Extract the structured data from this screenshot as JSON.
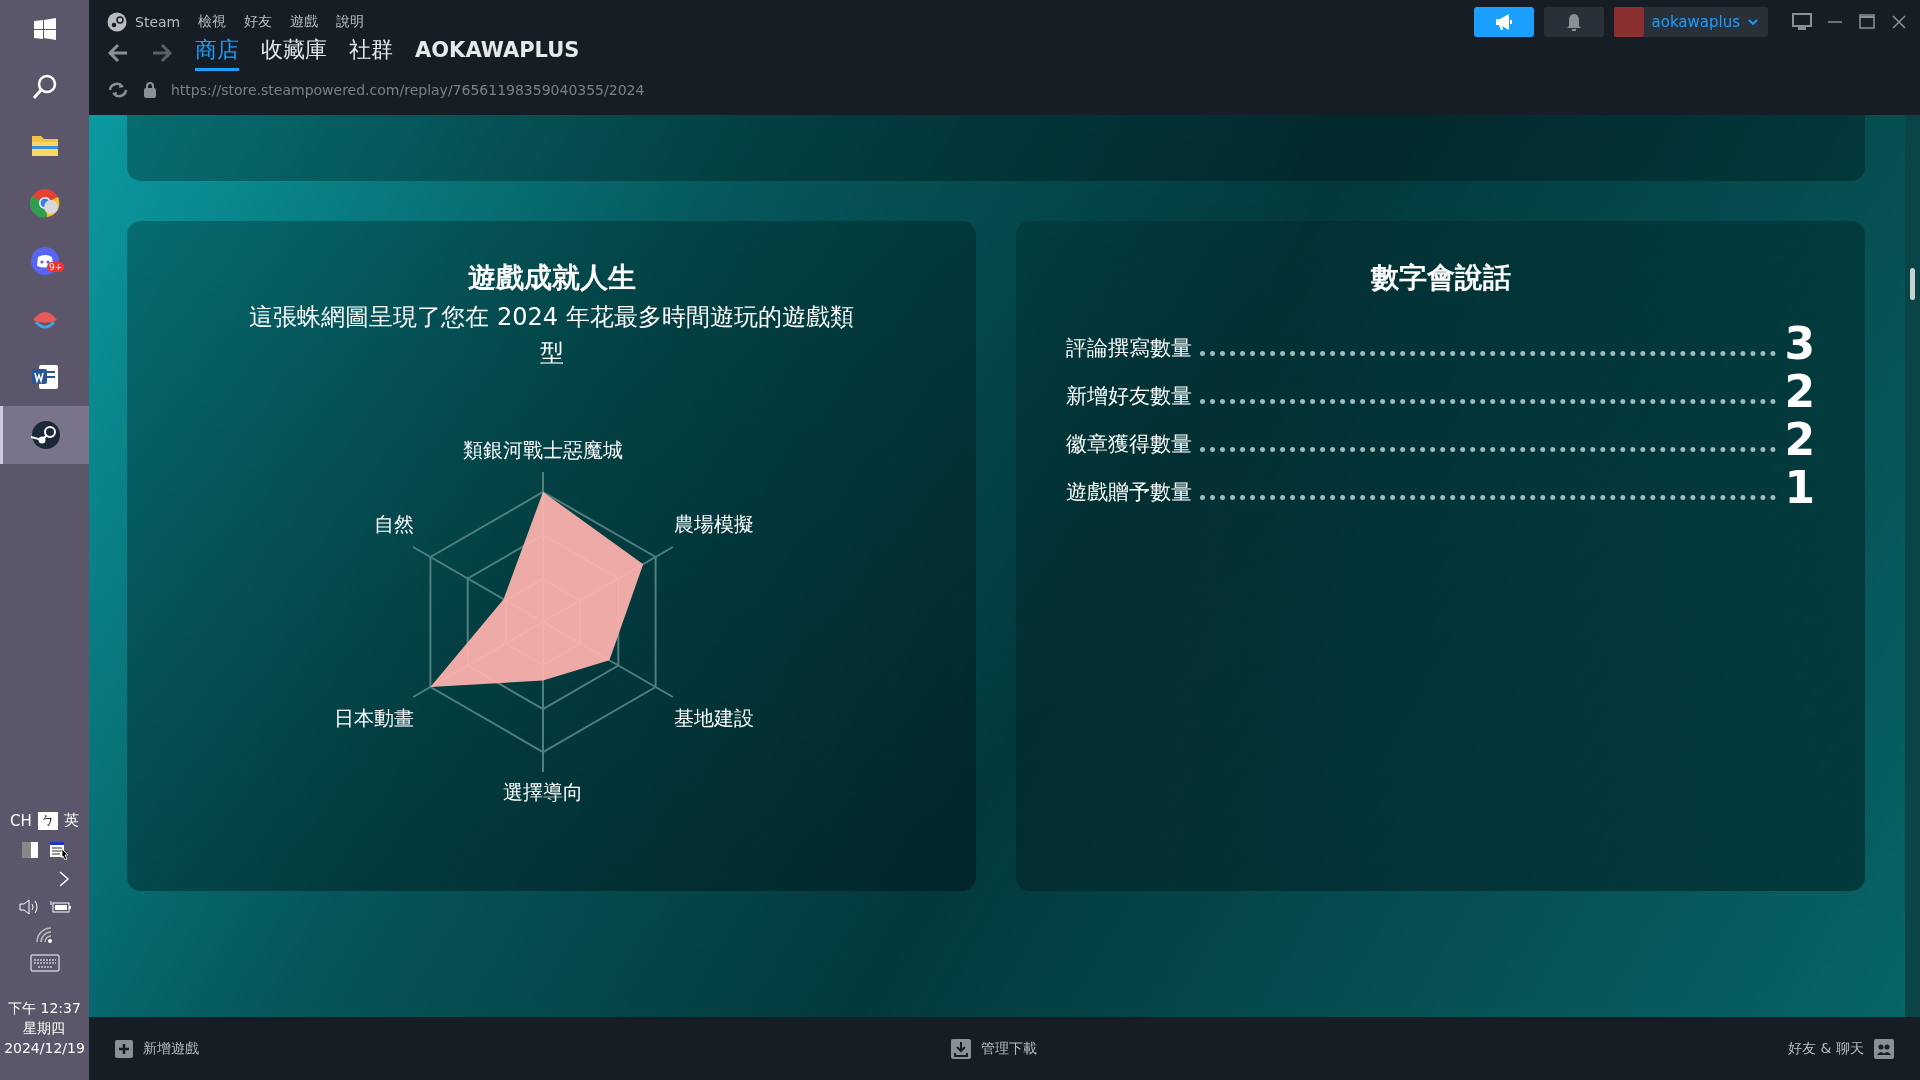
{
  "taskbar": {
    "apps": [
      {
        "kind": "start",
        "selected": false
      },
      {
        "kind": "search",
        "selected": false
      },
      {
        "kind": "folder",
        "selected": false
      },
      {
        "kind": "browser",
        "selected": false
      },
      {
        "kind": "chat",
        "selected": false,
        "badge": "9+"
      },
      {
        "kind": "shell",
        "selected": false
      },
      {
        "kind": "word",
        "selected": false
      },
      {
        "kind": "steam",
        "selected": true
      }
    ],
    "ime": [
      "CH",
      "ㄅ",
      "英"
    ],
    "clock": {
      "time": "下午 12:37",
      "day": "星期四",
      "date": "2024/12/19"
    }
  },
  "window": {
    "menu": [
      "Steam",
      "檢視",
      "好友",
      "遊戲",
      "說明"
    ],
    "username": "aokawaplus",
    "tabs": [
      {
        "label": "商店",
        "selected": true
      },
      {
        "label": "收藏庫",
        "selected": false
      },
      {
        "label": "社群",
        "selected": false
      },
      {
        "label": "AOKAWAPLUS",
        "selected": false
      }
    ],
    "url": "https://store.steampowered.com/replay/76561198359040355/2024"
  },
  "genre_card": {
    "title": "遊戲成就人生",
    "subtitle": "這張蛛網圖呈現了您在 2024 年花最多時間遊玩的遊戲類型",
    "axes": [
      "類銀河戰士惡魔城",
      "農場模擬",
      "基地建設",
      "選擇導向",
      "日本動畫",
      "自然"
    ]
  },
  "stats_card": {
    "title": "數字會說話",
    "rows": [
      {
        "label": "評論撰寫數量",
        "value": "3"
      },
      {
        "label": "新增好友數量",
        "value": "2"
      },
      {
        "label": "徽章獲得數量",
        "value": "2"
      },
      {
        "label": "遊戲贈予數量",
        "value": "1"
      }
    ]
  },
  "status_bar": {
    "add_game": "新增遊戲",
    "downloads": "管理下載",
    "friends": "好友 & 聊天"
  }
}
